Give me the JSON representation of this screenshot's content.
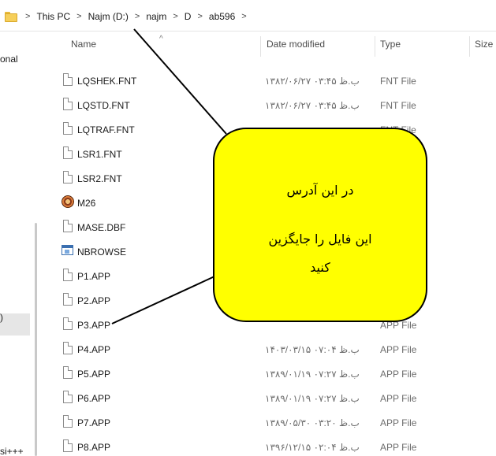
{
  "breadcrumb": {
    "items": [
      "This PC",
      "Najm (D:)",
      "najm",
      "D",
      "ab596"
    ]
  },
  "nav": {
    "fragments": [
      "onal",
      ")",
      "si+++"
    ]
  },
  "columns": {
    "name": "Name",
    "date_modified": "Date modified",
    "type": "Type",
    "size": "Size"
  },
  "files": [
    {
      "name": "LQSHEK.FNT",
      "date": "۱۳۸۲/۰۶/۲۷ ب.ظ ۰۳:۴۵",
      "type": "FNT File",
      "icon": "generic-file-icon"
    },
    {
      "name": "LQSTD.FNT",
      "date": "۱۳۸۲/۰۶/۲۷ ب.ظ ۰۳:۴۵",
      "type": "FNT File",
      "icon": "generic-file-icon"
    },
    {
      "name": "LQTRAF.FNT",
      "date": "",
      "type": "FNT File",
      "icon": "generic-file-icon"
    },
    {
      "name": "LSR1.FNT",
      "date": "",
      "type": "",
      "icon": "generic-file-icon"
    },
    {
      "name": "LSR2.FNT",
      "date": "",
      "type": "",
      "icon": "generic-file-icon"
    },
    {
      "name": "M26",
      "date": "",
      "type": "",
      "icon": "m26-icon"
    },
    {
      "name": "MASE.DBF",
      "date": "",
      "type": "",
      "icon": "generic-file-icon"
    },
    {
      "name": "NBROWSE",
      "date": "",
      "type": "",
      "icon": "application-icon"
    },
    {
      "name": "P1.APP",
      "date": "",
      "type": "",
      "icon": "generic-file-icon"
    },
    {
      "name": "P2.APP",
      "date": "",
      "type": "",
      "icon": "generic-file-icon"
    },
    {
      "name": "P3.APP",
      "date": "",
      "type": "APP File",
      "icon": "generic-file-icon"
    },
    {
      "name": "P4.APP",
      "date": "۱۴۰۳/۰۳/۱۵ ب.ظ ۰۷:۰۴",
      "type": "APP File",
      "icon": "generic-file-icon"
    },
    {
      "name": "P5.APP",
      "date": "۱۳۸۹/۰۱/۱۹ ب.ظ ۰۷:۲۷",
      "type": "APP File",
      "icon": "generic-file-icon"
    },
    {
      "name": "P6.APP",
      "date": "۱۳۸۹/۰۱/۱۹ ب.ظ ۰۷:۲۷",
      "type": "APP File",
      "icon": "generic-file-icon"
    },
    {
      "name": "P7.APP",
      "date": "۱۳۸۹/۰۵/۳۰ ب.ظ ۰۳:۲۰",
      "type": "APP File",
      "icon": "generic-file-icon"
    },
    {
      "name": "P8.APP",
      "date": "۱۳۹۶/۱۲/۱۵ ب.ظ ۰۲:۰۴",
      "type": "APP File",
      "icon": "generic-file-icon"
    }
  ],
  "callout": {
    "line1": "در این آدرس",
    "line2": "این فایل را جایگزین",
    "line3": "کنید",
    "fill_color": "#ffff00"
  }
}
